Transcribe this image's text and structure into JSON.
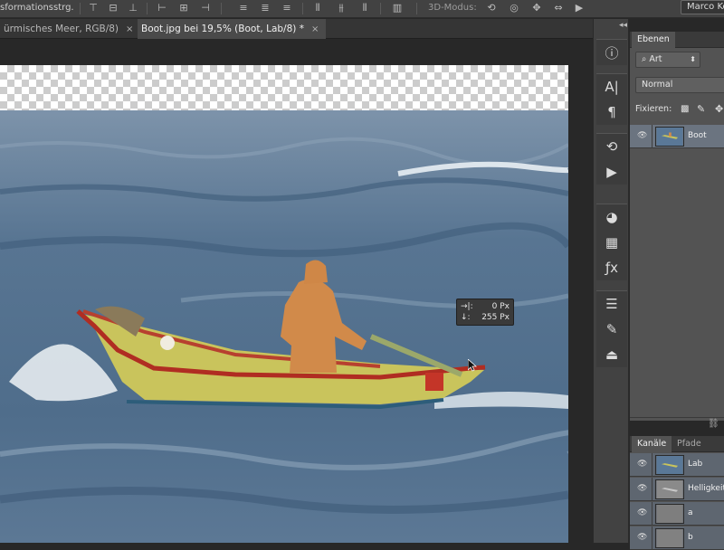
{
  "optionsbar": {
    "left_label": "sformationsstrg.",
    "mode_3d": "3D-Modus:",
    "user": "Marco Ko"
  },
  "tabs": [
    {
      "label": "ürmisches Meer, RGB/8)",
      "close": "×"
    },
    {
      "label": "Boot.jpg bei 19,5% (Boot, Lab/8) *",
      "close": "×"
    }
  ],
  "tooltip": {
    "row1_icon": "→|:",
    "row1_value": "0 Px",
    "row2_icon": "↓:",
    "row2_value": "255 Px"
  },
  "toolstrip": {
    "collapse": "◂◂"
  },
  "layers_panel": {
    "tab": "Ebenen",
    "filter_label": "Art",
    "blend_mode": "Normal",
    "lock_label": "Fixieren:",
    "layers": [
      {
        "name": "Boot"
      }
    ]
  },
  "channels_panel": {
    "tabs": [
      "Kanäle",
      "Pfade"
    ],
    "channels": [
      {
        "name": "Lab"
      },
      {
        "name": "Helligkeit"
      },
      {
        "name": "a"
      },
      {
        "name": "b"
      }
    ]
  },
  "colors": {
    "accent_selected": "#6b7480",
    "panel_bg": "#535353"
  }
}
